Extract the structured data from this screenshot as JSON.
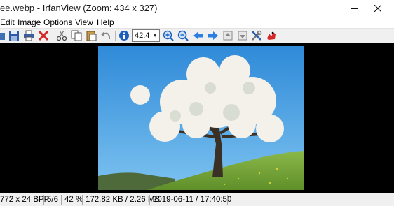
{
  "window": {
    "title": "ee.webp - IrfanView (Zoom: 434 x 327)",
    "minimize_icon": "minimize-icon",
    "close_icon": "close-icon"
  },
  "menu": [
    "Edit",
    "Image",
    "Options",
    "View",
    "Help"
  ],
  "toolbar": {
    "zoom_value": "42.4",
    "icons": [
      "folder-open-icon",
      "save-icon",
      "print-icon",
      "delete-icon",
      "cut-icon",
      "copy-icon",
      "paste-icon",
      "undo-icon",
      "info-icon",
      "zoom-in-icon",
      "zoom-out-icon",
      "previous-icon",
      "next-icon",
      "first-page-icon",
      "last-page-icon",
      "properties-icon",
      "irfanview-logo-icon"
    ]
  },
  "statusbar": {
    "dimensions": "772 x 24 BPP",
    "index": "5/6",
    "zoom": "42 %",
    "size": "172.82 KB / 2.26 MB",
    "datetime": "2019-06-11 / 17:40:50"
  },
  "colors": {
    "canvas_bg": "#000000",
    "toolbar_bg": "#f0f0f0",
    "arrow_blue": "#2a7fe0",
    "delete_red": "#d62828"
  }
}
